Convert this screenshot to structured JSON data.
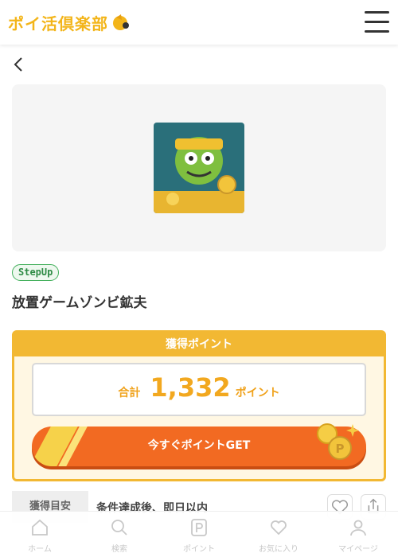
{
  "header": {
    "logo_text": "ポイ活倶楽部"
  },
  "app": {
    "badge": "StepUp",
    "title": "放置ゲームゾンビ鉱夫"
  },
  "points": {
    "heading": "獲得ポイント",
    "total_label": "合計",
    "total_value": "1,332",
    "unit": "ポイント",
    "get_button": "今すぐポイントGET"
  },
  "info": {
    "label": "獲得目安",
    "value": "条件達成後、即日以内"
  },
  "nav": {
    "items": [
      {
        "label": "ホーム",
        "icon": "home-icon"
      },
      {
        "label": "検索",
        "icon": "search-icon"
      },
      {
        "label": "ポイント",
        "icon": "point-icon"
      },
      {
        "label": "お気に入り",
        "icon": "heart-icon"
      },
      {
        "label": "マイページ",
        "icon": "user-icon"
      }
    ]
  },
  "colors": {
    "brand": "#f3b51a",
    "button": "#f26a22",
    "badge": "#43b05c"
  }
}
